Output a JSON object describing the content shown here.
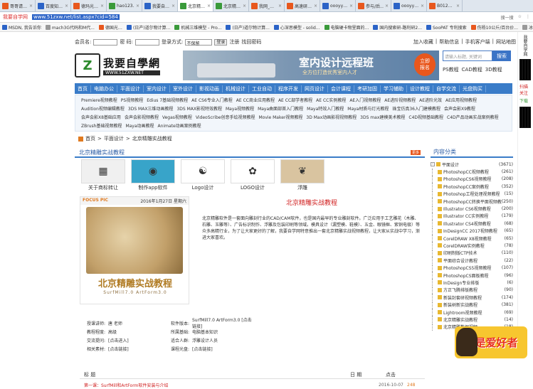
{
  "tabs": [
    {
      "label": "哥哥请…",
      "color": "#e8571d",
      "active": false
    },
    {
      "label": "百度知…",
      "color": "#2b63c7",
      "active": false
    },
    {
      "label": "德玛光…",
      "color": "#e8571d",
      "active": false
    },
    {
      "label": "hao123…",
      "color": "#3a9a3a",
      "active": false
    },
    {
      "label": "我要自…",
      "color": "#2b63c7",
      "active": false
    },
    {
      "label": "北京精…",
      "color": "#3a9a3a",
      "active": true
    },
    {
      "label": "北京精…",
      "color": "#3a9a3a",
      "active": false
    },
    {
      "label": "我网_…",
      "color": "#e8571d",
      "active": false
    },
    {
      "label": "高速研…",
      "color": "#e8571d",
      "active": false
    },
    {
      "label": "oooyy…",
      "color": "#2b63c7",
      "active": false
    },
    {
      "label": "参与/后…",
      "color": "#e8571d",
      "active": false
    },
    {
      "label": "oooyy…",
      "color": "#2b63c7",
      "active": false
    },
    {
      "label": "B012…",
      "color": "#e8571d",
      "active": false
    }
  ],
  "address": {
    "brand": "我要自学网",
    "url": "www.51zxw.net/list.aspx?cid=584",
    "right_items": [
      "搜一搜",
      "☆",
      "⋮"
    ]
  },
  "bookmarks": [
    {
      "label": "MSDN, 我告诉你",
      "color": "#2b63c7"
    },
    {
      "label": "mach3G代码和M代...",
      "color": "#999"
    },
    {
      "label": "德国光…",
      "color": "#e8571d"
    },
    {
      "label": "(日产)道尔物计算...",
      "color": "#2b63c7"
    },
    {
      "label": "机械三维模型 - Pro...",
      "color": "#3a9a3a"
    },
    {
      "label": "(日产)道尔物计算...",
      "color": "#2b63c7"
    },
    {
      "label": "心深思模型 - solid...",
      "color": "#2b63c7"
    },
    {
      "label": "电脑硬卡物里面的...",
      "color": "#3a9a3a"
    },
    {
      "label": "国内搜索研-路利研2...",
      "color": "#2b63c7"
    },
    {
      "label": "SooPAT 专利搜索",
      "color": "#2b63c7"
    },
    {
      "label": "伤杨10公斤/百台价...",
      "color": "#e8571d"
    },
    {
      "label": "冰衣",
      "color": "#999"
    }
  ],
  "topline": {
    "member_label": "会员名:",
    "password_label": "密 码:",
    "login_method_label": "登录方式:",
    "login_method_value": "不保留",
    "login_btn": "登录",
    "register": "注册",
    "find_pwd": "找回密码",
    "right_links": [
      "加入收藏",
      "帮助信息",
      "手机客户端",
      "网站地图"
    ]
  },
  "logo": {
    "mark": "Z",
    "title": "我要自學網",
    "sub": "WWW.51ZXW.NET"
  },
  "banner": {
    "headline": "室内设计远程班",
    "sub": "全方位打造优秀室内人才",
    "badge": "立即\n报名"
  },
  "search": {
    "placeholder": "请输入标题, 关键词",
    "button": "搜索",
    "links": [
      "PS教程",
      "CAD教程",
      "3D教程"
    ]
  },
  "nav": [
    "首页",
    "电脑办公",
    "平面设计",
    "室内设计",
    "室外设计",
    "影视动画",
    "机械设计",
    "工业自动",
    "程序开发",
    "网页设计",
    "会计课程",
    "考研加固",
    "学习辅助",
    "设计教程",
    "自学交流",
    "光盘购买"
  ],
  "sublinks": [
    "Premiere视频教程",
    "PS视频教程",
    "Edius 7基础视频教程",
    "AE CS6专业入门教程",
    "AE CC商业应用教程",
    "AE CC部学者教程",
    "AE CC实例教程",
    "AE入门视频教程",
    "AE进阶视频教程",
    "AE进阶光效",
    "AE应用视频教程",
    "Audition视频编辑教程",
    "3DS MAX三维动画教程",
    "3DS MAX影视特效教程",
    "Maya视频教程",
    "Maya曲面部首入门教程",
    "Maya特效入门教程",
    "Maya材质与灯光教程",
    "珠宝仿真36入门建模教程",
    "会声会影X9教程",
    "会声会影X8基础应用",
    "会声会影视频教程",
    "Vegas视频教程",
    "VideoScribe创意手绘视频教程",
    "Movie Maker视频教程",
    "3D Max动画影视视频教程",
    "3DS max建模美术教程",
    "C4D视频基础教程",
    "C4D产品动画实战案例教程",
    "ZBrush基础视频教程",
    "Maya动画教程",
    "Animate动画案例教程"
  ],
  "crumb": [
    "首页",
    "平面设计",
    "北京精雕实战教程"
  ],
  "section_title": "北京精雕实战教程",
  "section_more": "更多",
  "thumbs": [
    {
      "caption": "关于商标转让",
      "glyph": "▦",
      "bg": "#f0f0f0"
    },
    {
      "caption": "制作app软件",
      "glyph": "◉",
      "bg": "#38a4c9"
    },
    {
      "caption": "Logo设计",
      "glyph": "☯",
      "bg": "#ffffff"
    },
    {
      "caption": "LOGO设计",
      "glyph": "✿",
      "bg": "#ffffff"
    },
    {
      "caption": "浮雕",
      "glyph": "❦",
      "bg": "#d9c4a0"
    }
  ],
  "focus": {
    "tag": "FOCUS PIC",
    "date": "2016年1月27日 星期六",
    "title": "北京精雕实战教程",
    "sub": "SurfMill7.0 ArtForm3.0"
  },
  "intro": {
    "title": "北京精雕实战教程",
    "body": "北京精雕软件是一套面向雕刻行业的CAD/CAM软件，也是国内最早的专业雕刻软件。广泛应用于工艺雕花（木雕、石雕、玉雕等）、广告标识制作、浮雕及包装印刷等领域。模具设计（漏塑模、鞋模）、五金、眼镜框、紫铜电极）等众多高精行业，为了让大家更好的了解，我要自学网特意推出一套北京精雕实战视频教程，让大家从实战中学习，渐进大家喜欢。"
  },
  "meta": [
    {
      "k1": "授课讲师:",
      "v1": "唐 老师",
      "k2": "软件版本:",
      "v2": "SurfMill7.0 ArtForm3.0 [点击链接]"
    },
    {
      "k1": "教程程度:",
      "v1": "高级",
      "k2": "所属基础:",
      "v2": "电脑基本知识"
    },
    {
      "k1": "交流提问:",
      "v1": "[点击进入]",
      "k2": "适合人群:",
      "v2": "浮雕设计人员"
    },
    {
      "k1": "相关素材:",
      "v1": "[点击链接]",
      "k2": "课程光盘:",
      "v2": "[点击链接]"
    }
  ],
  "list_header": {
    "title": "标 题",
    "date": "日 期",
    "clicks": "点击"
  },
  "list_row": {
    "title": "第一课：SurfMill和ArtForm软件安装与介绍",
    "date": "2016-10-07",
    "clicks": "248"
  },
  "sidebar": {
    "title": "内容分类",
    "items": [
      {
        "label": "平面设计",
        "count": "(3671)",
        "level": 0,
        "expander": "-"
      },
      {
        "label": "PhotoshopCC视频教程",
        "count": "(261)",
        "level": 1
      },
      {
        "label": "PhotoshopCS6视频教程",
        "count": "(208)",
        "level": 1
      },
      {
        "label": "PhotoshopCC案例教程",
        "count": "(352)",
        "level": 1
      },
      {
        "label": "Photoshop工程处理视频教程",
        "count": "(15)",
        "level": 1
      },
      {
        "label": "PhotoshopCC转换平面视频教程",
        "count": "(250)",
        "level": 1
      },
      {
        "label": "Illustrator CS6视频教程",
        "count": "(200)",
        "level": 1
      },
      {
        "label": "Illustrator CC实例教程",
        "count": "(179)",
        "level": 1
      },
      {
        "label": "Illustrator CS4视频教程",
        "count": "(68)",
        "level": 1
      },
      {
        "label": "InDesignCC 2017视频教程",
        "count": "(65)",
        "level": 1
      },
      {
        "label": "CorelDRAW X8视频教程",
        "count": "(65)",
        "level": 1
      },
      {
        "label": "CorelDRAW实例教程",
        "count": "(78)",
        "level": 1
      },
      {
        "label": "印刷制版CTP技术",
        "count": "(110)",
        "level": 1
      },
      {
        "label": "平面综合设计教程",
        "count": "(22)",
        "level": 1
      },
      {
        "label": "PhotoshopCS5视频教程",
        "count": "(107)",
        "level": 1
      },
      {
        "label": "PhotoshopCS面板教程",
        "count": "(96)",
        "level": 1
      },
      {
        "label": "InDesign专业排版",
        "count": "(6)",
        "level": 1
      },
      {
        "label": "方正飞腾排版教程",
        "count": "(90)",
        "level": 1
      },
      {
        "label": "新装封套研视频教程",
        "count": "(174)",
        "level": 1
      },
      {
        "label": "新装树新实战教程",
        "count": "(381)",
        "level": 1
      },
      {
        "label": "Lightroom视频教程",
        "count": "(69)",
        "level": 1
      },
      {
        "label": "北京精雕实战教程",
        "count": "(14)",
        "level": 1
      },
      {
        "label": "北京精雕数据视频…",
        "count": "(18)",
        "level": 1
      }
    ]
  },
  "farright": {
    "label": "我要自学网",
    "t1": "扫描关注",
    "t2": "下载",
    "mascot": "我是爱好者"
  }
}
